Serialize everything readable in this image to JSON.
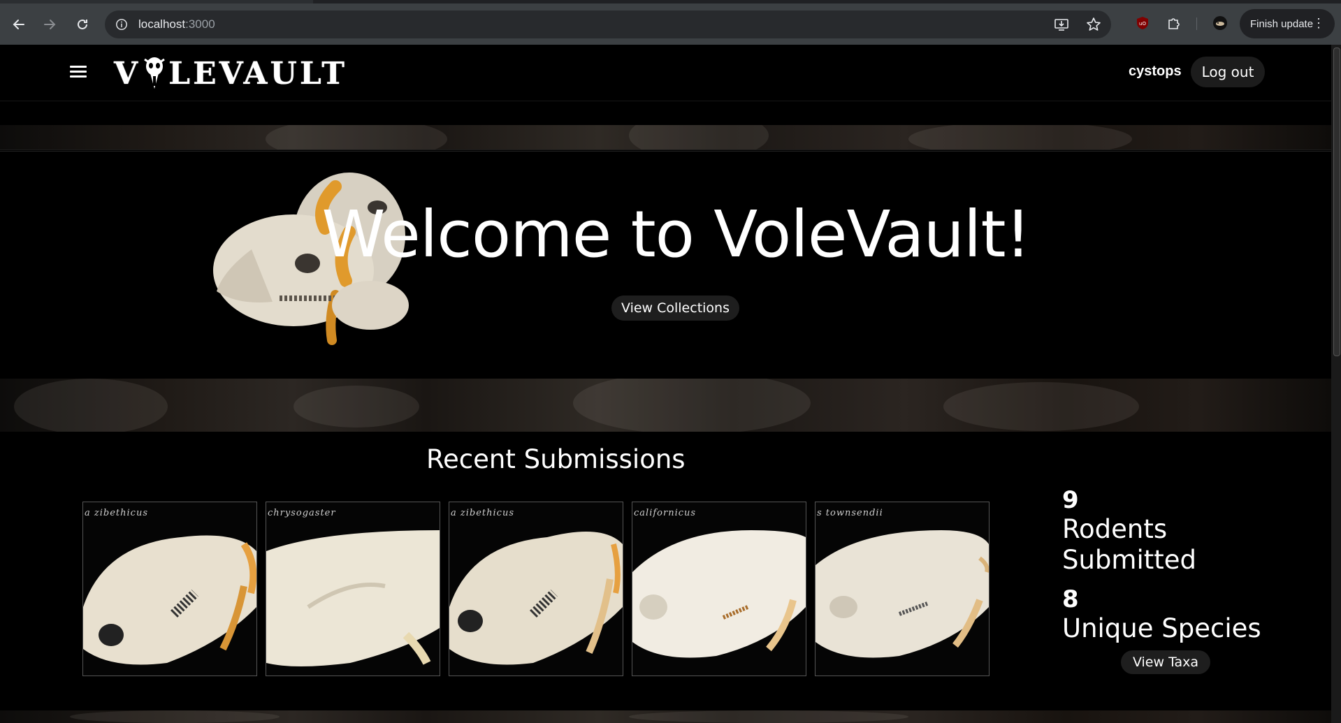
{
  "browser": {
    "url_host": "localhost",
    "url_port": ":3000",
    "update_label": "Finish update"
  },
  "header": {
    "logo_prefix": "V",
    "logo_suffix": "LEVAULT",
    "username": "cystops",
    "logout_label": "Log out"
  },
  "hero": {
    "title": "Welcome to VoleVault!",
    "collections_label": "View Collections"
  },
  "recent": {
    "title": "Recent Submissions",
    "items": [
      {
        "caption": "a zibethicus"
      },
      {
        "caption": "chrysogaster"
      },
      {
        "caption": "a zibethicus"
      },
      {
        "caption": "californicus"
      },
      {
        "caption": "s townsendii"
      }
    ]
  },
  "stats": {
    "rodents_count": "9",
    "rodents_label": "Rodents Submitted",
    "species_count": "8",
    "species_label": "Unique Species",
    "taxa_label": "View Taxa"
  },
  "colors": {
    "page_bg": "#000000",
    "button_bg": "#1e1e1e",
    "chrome_bg": "#3c4043"
  },
  "icons": {
    "back": "arrow-left-icon",
    "forward": "arrow-right-icon",
    "reload": "reload-icon",
    "info": "info-icon",
    "install": "install-icon",
    "bookmark": "star-icon",
    "ublock": "ublock-icon",
    "extensions": "puzzle-icon",
    "profile": "profile-avatar-icon",
    "menu": "hamburger-icon"
  }
}
